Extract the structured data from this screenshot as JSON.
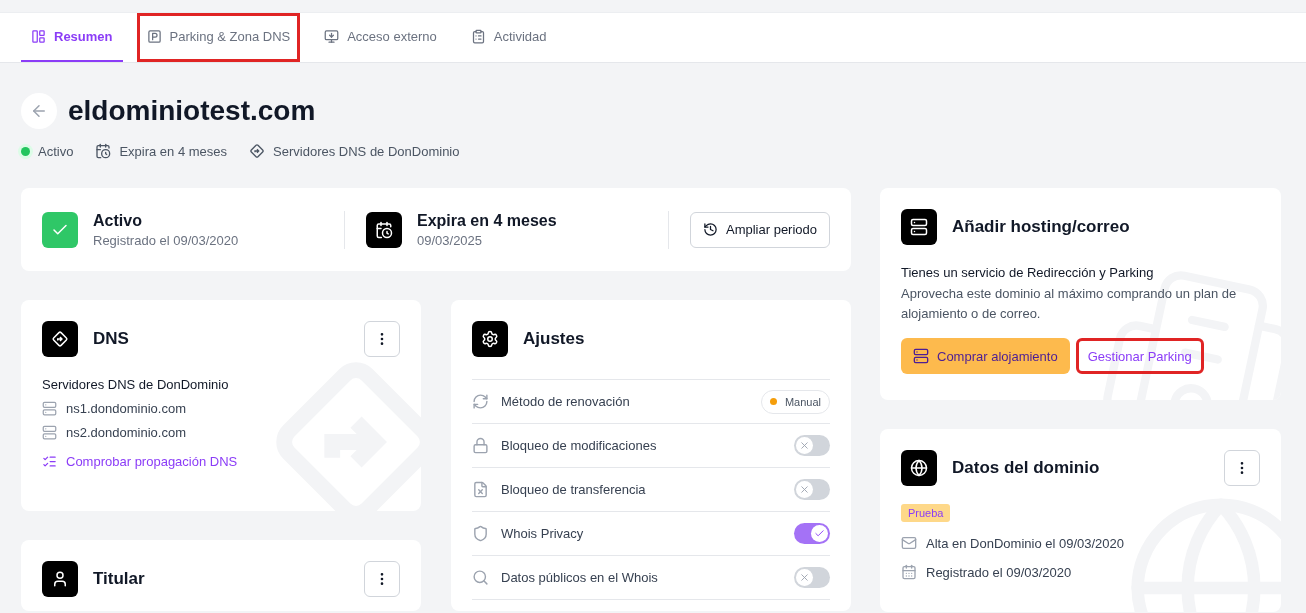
{
  "tabs": [
    {
      "label": "Resumen",
      "selected": true,
      "highlighted": false
    },
    {
      "label": "Parking & Zona DNS",
      "selected": false,
      "highlighted": true
    },
    {
      "label": "Acceso externo",
      "selected": false,
      "highlighted": false
    },
    {
      "label": "Actividad",
      "selected": false,
      "highlighted": false
    }
  ],
  "domain": {
    "title": "eldominiotest.com",
    "meta": [
      {
        "kind": "status",
        "label": "Activo",
        "color": "#22c55e"
      },
      {
        "kind": "expiry",
        "label": "Expira en 4 meses"
      },
      {
        "kind": "dns",
        "label": "Servidores DNS de DonDominio"
      }
    ]
  },
  "summary": {
    "status": {
      "title": "Activo",
      "subtitle": "Registrado el 09/03/2020"
    },
    "expiry": {
      "title": "Expira en 4 meses",
      "subtitle": "09/03/2025"
    },
    "button": "Ampliar periodo"
  },
  "dns": {
    "title": "DNS",
    "heading": "Servidores DNS de DonDominio",
    "servers": [
      "ns1.dondominio.com",
      "ns2.dondominio.com"
    ],
    "link": "Comprobar propagación DNS"
  },
  "holder": {
    "title": "Titular"
  },
  "settings": {
    "title": "Ajustes",
    "rows": [
      {
        "kind": "badge",
        "label": "Método de renovación",
        "value": "Manual",
        "color": "#f59e0b"
      },
      {
        "kind": "toggle",
        "label": "Bloqueo de modificaciones",
        "on": false
      },
      {
        "kind": "toggle",
        "label": "Bloqueo de transferencia",
        "on": false
      },
      {
        "kind": "toggle",
        "label": "Whois Privacy",
        "on": true
      },
      {
        "kind": "toggle",
        "label": "Datos públicos en el Whois",
        "on": false
      }
    ]
  },
  "hosting": {
    "title": "Añadir hosting/correo",
    "heading": "Tienes un servicio de Redirección y Parking",
    "text": "Aprovecha este dominio al máximo comprando un plan de alojamiento o de correo.",
    "buttons": [
      {
        "kind": "primary",
        "label": "Comprar alojamiento",
        "highlighted": false
      },
      {
        "kind": "link",
        "label": "Gestionar Parking",
        "highlighted": true
      }
    ]
  },
  "domain_data": {
    "title": "Datos del dominio",
    "tag": "Prueba",
    "items": [
      "Alta en DonDominio el 09/03/2020",
      "Registrado el 09/03/2020"
    ]
  }
}
